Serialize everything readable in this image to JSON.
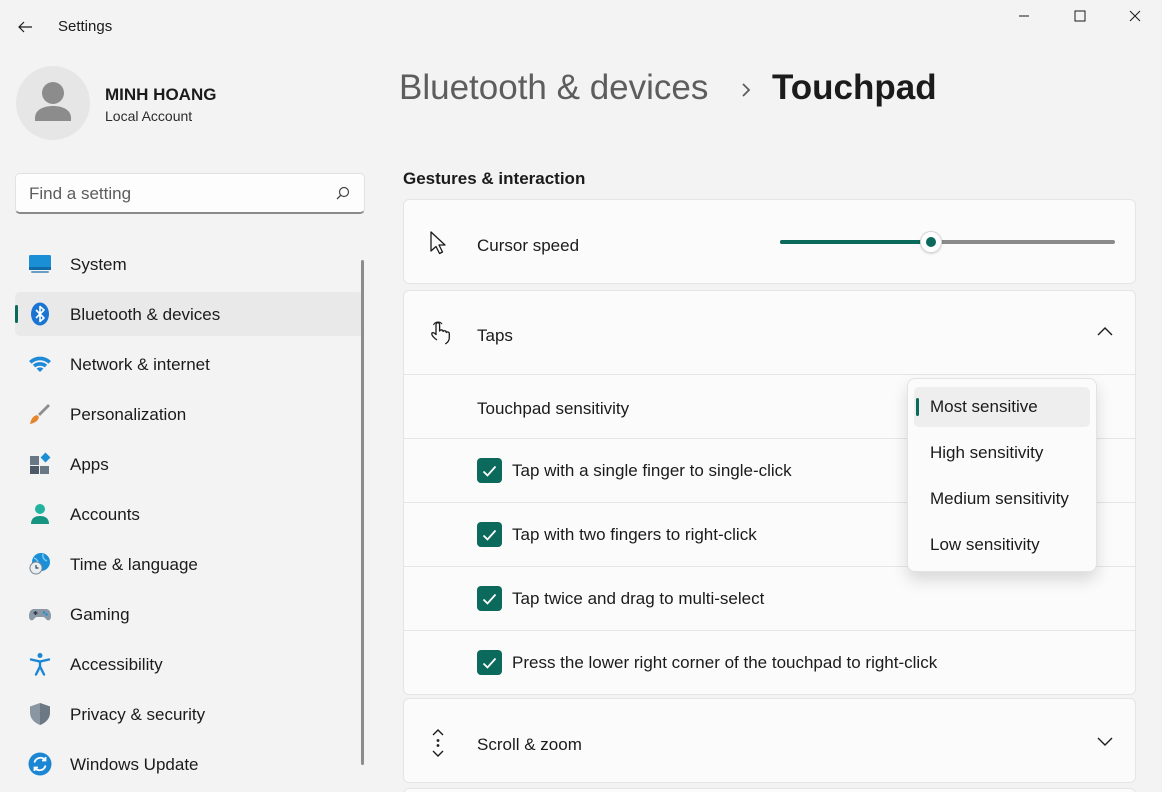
{
  "window": {
    "title": "Settings",
    "controls": [
      "minimize-icon",
      "maximize-icon",
      "close-icon"
    ]
  },
  "profile": {
    "name": "MINH HOANG",
    "account_type": "Local Account"
  },
  "search": {
    "placeholder": "Find a setting"
  },
  "sidebar": {
    "items": [
      {
        "label": "System",
        "icon": "monitor-icon",
        "selected": false
      },
      {
        "label": "Bluetooth & devices",
        "icon": "bluetooth-icon",
        "selected": true
      },
      {
        "label": "Network & internet",
        "icon": "wifi-icon",
        "selected": false
      },
      {
        "label": "Personalization",
        "icon": "paintbrush-icon",
        "selected": false
      },
      {
        "label": "Apps",
        "icon": "apps-icon",
        "selected": false
      },
      {
        "label": "Accounts",
        "icon": "person-icon",
        "selected": false
      },
      {
        "label": "Time & language",
        "icon": "globe-clock-icon",
        "selected": false
      },
      {
        "label": "Gaming",
        "icon": "gamepad-icon",
        "selected": false
      },
      {
        "label": "Accessibility",
        "icon": "accessibility-icon",
        "selected": false
      },
      {
        "label": "Privacy & security",
        "icon": "shield-icon",
        "selected": false
      },
      {
        "label": "Windows Update",
        "icon": "update-icon",
        "selected": false
      }
    ]
  },
  "header": {
    "breadcrumb_parent": "Bluetooth & devices",
    "breadcrumb_current": "Touchpad"
  },
  "main": {
    "section_title": "Gestures & interaction",
    "cursor_speed": {
      "label": "Cursor speed",
      "value_fraction": 0.45
    },
    "taps": {
      "label": "Taps",
      "expanded": true,
      "sensitivity_label": "Touchpad sensitivity",
      "checkboxes": [
        {
          "label": "Tap with a single finger to single-click",
          "checked": true
        },
        {
          "label": "Tap with two fingers to right-click",
          "checked": true
        },
        {
          "label": "Tap twice and drag to multi-select",
          "checked": true
        },
        {
          "label": "Press the lower right corner of the touchpad to right-click",
          "checked": true
        }
      ]
    },
    "scroll_zoom": {
      "label": "Scroll & zoom",
      "expanded": false
    }
  },
  "dropdown": {
    "options": [
      "Most sensitive",
      "High sensitivity",
      "Medium sensitivity",
      "Low sensitivity"
    ],
    "selected_index": 0
  },
  "colors": {
    "accent": "#0b6a5b",
    "background": "#f3f3f3",
    "card": "#fbfbfb"
  }
}
